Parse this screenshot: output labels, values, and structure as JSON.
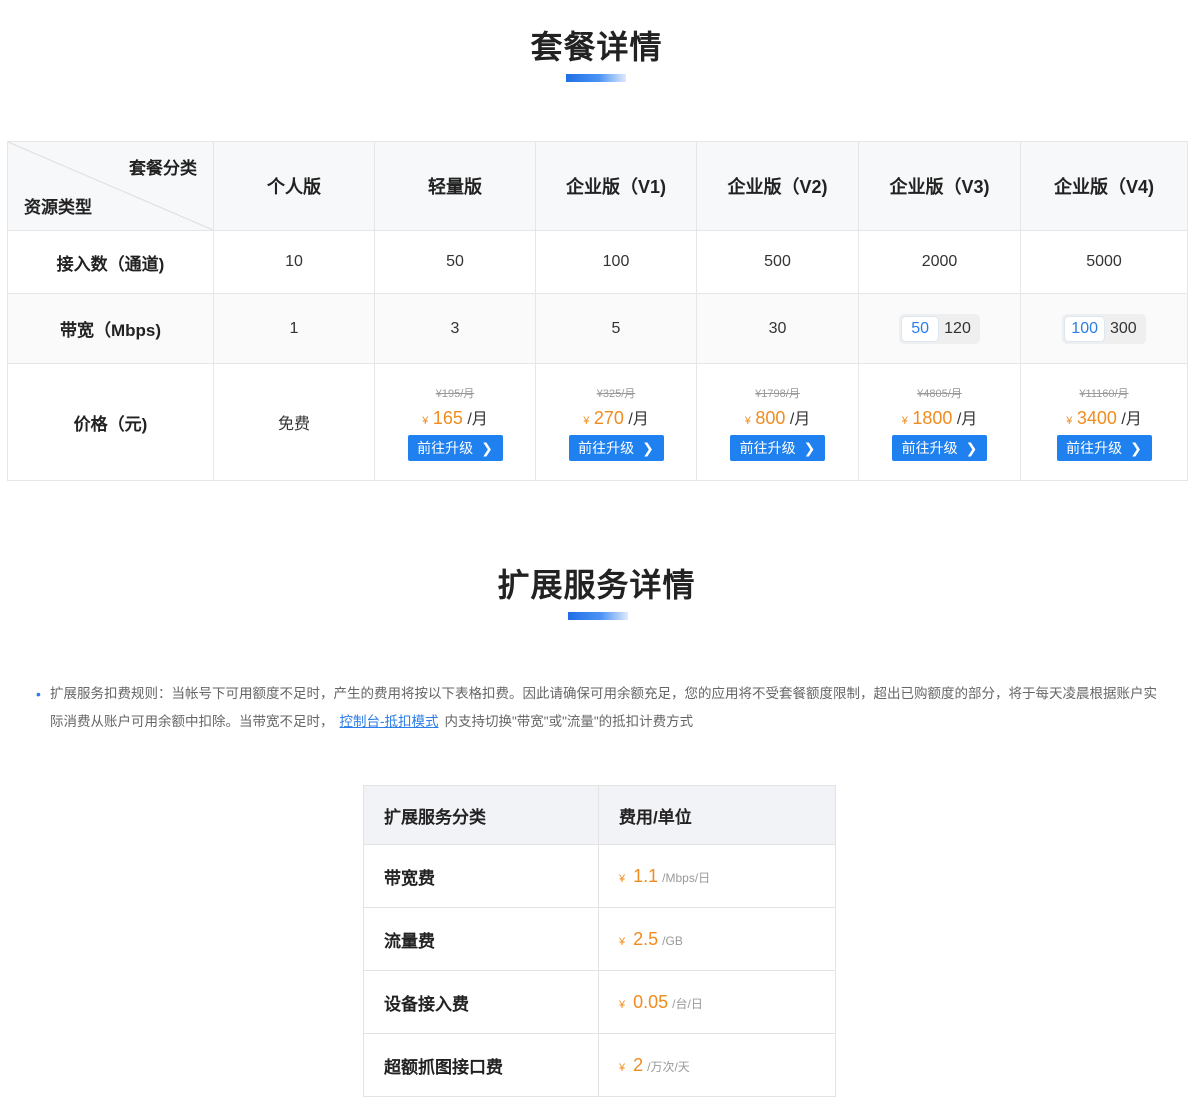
{
  "plans_section": {
    "title": "套餐详情",
    "corner_top": "套餐分类",
    "corner_bottom": "资源类型",
    "plans": [
      {
        "name": "个人版"
      },
      {
        "name": "轻量版"
      },
      {
        "name": "企业版（V1)"
      },
      {
        "name": "企业版（V2)"
      },
      {
        "name": "企业版（V3)"
      },
      {
        "name": "企业版（V4)"
      }
    ],
    "rows": {
      "connections": {
        "label": "接入数（通道)",
        "values": [
          "10",
          "50",
          "100",
          "500",
          "2000",
          "5000"
        ]
      },
      "bandwidth": {
        "label": "带宽（Mbps)",
        "values": [
          "1",
          "3",
          "5",
          "30"
        ],
        "v3_options": [
          "50",
          "120"
        ],
        "v3_selected": "50",
        "v4_options": [
          "100",
          "300"
        ],
        "v4_selected": "100"
      },
      "price": {
        "label": "价格（元)",
        "free_label": "免费",
        "currency": "¥",
        "unit": "/月",
        "button_label": "前往升级",
        "items": [
          {
            "original": "¥195/月",
            "current": "165"
          },
          {
            "original": "¥325/月",
            "current": "270"
          },
          {
            "original": "¥1798/月",
            "current": "800"
          },
          {
            "original": "¥4805/月",
            "current": "1800"
          },
          {
            "original": "¥11160/月",
            "current": "3400"
          }
        ]
      }
    }
  },
  "extension_section": {
    "title": "扩展服务详情",
    "note_before_link": "扩展服务扣费规则：当帐号下可用额度不足时，产生的费用将按以下表格扣费。因此请确保可用余额充足，您的应用将不受套餐额度限制，超出已购额度的部分，将于每天凌晨根据账户实际消费从账户可用余额中扣除。当带宽不足时，",
    "note_link": "控制台-抵扣模式",
    "note_after_link": "内支持切换\"带宽\"或\"流量\"的抵扣计费方式",
    "table": {
      "col_category": "扩展服务分类",
      "col_price": "费用/单位",
      "currency": "¥",
      "rows": [
        {
          "name": "带宽费",
          "value": "1.1",
          "unit": "/Mbps/日"
        },
        {
          "name": "流量费",
          "value": "2.5",
          "unit": "/GB"
        },
        {
          "name": "设备接入费",
          "value": "0.05",
          "unit": "/台/日"
        },
        {
          "name": "超额抓图接口费",
          "value": "2",
          "unit": "/万次/天"
        }
      ]
    }
  },
  "colors": {
    "accent": "#1f80f0",
    "price": "#f08c1e"
  }
}
